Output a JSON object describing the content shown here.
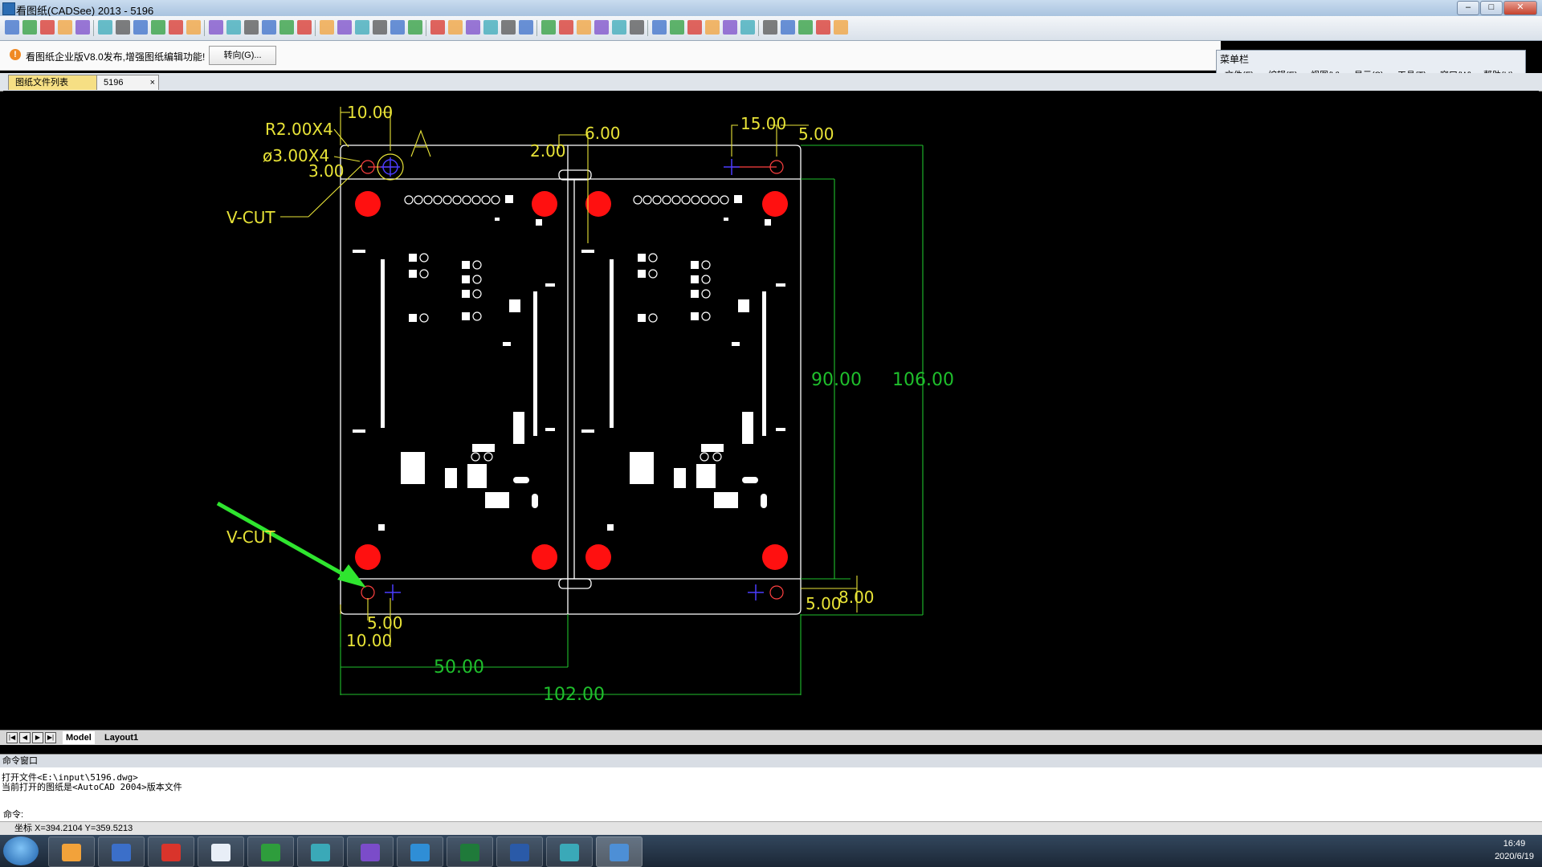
{
  "window": {
    "title": "看图纸(CADSee) 2013 - 5196",
    "controls": {
      "minimize": "–",
      "maximize": "□",
      "close": "✕"
    }
  },
  "notice": {
    "message": "看图纸企业版V8.0发布,增强图纸编辑功能!",
    "goto_label": "转向(G)..."
  },
  "menu_panel": {
    "caption": "菜单栏",
    "close": "×",
    "items": [
      "文件(F)",
      "编辑(E)",
      "视图(V)",
      "显示(S)",
      "工具(T)",
      "窗口(W)",
      "帮助(H)"
    ]
  },
  "tabs": {
    "file_list": "图纸文件列表",
    "current": "5196",
    "close": "×"
  },
  "layout_tabs": [
    "Model",
    "Layout1"
  ],
  "drawing": {
    "labels": {
      "r2": "R2.00X4",
      "phi3": "ø3.00X4",
      "dim3": "3.00",
      "vcut_top": "V-CUT",
      "vcut_bottom": "V-CUT",
      "marker_a": "A",
      "d10_top": "10.00",
      "d2": "2.00",
      "d6": "6.00",
      "d15": "15.00",
      "d5_top": "5.00",
      "d90": "90.00",
      "d106": "106.00",
      "d5_bl": "5.00",
      "d10_bl": "10.00",
      "d50": "50.00",
      "d102": "102.00",
      "d5_br": "5.00",
      "d8": "8.00"
    }
  },
  "command_window": {
    "caption": "命令窗口",
    "lines": [
      "打开文件<E:\\input\\5196.dwg>",
      "当前打开的图纸是<AutoCAD 2004>版本文件"
    ],
    "prompt": "命令:"
  },
  "status": {
    "coords": "坐标 X=394.2104 Y=359.5213"
  },
  "taskbar": {
    "clock_time": "16:49",
    "clock_date": "2020/6/19"
  },
  "colors": {
    "canvas": "#000000",
    "dimension_yellow": "#e8e337",
    "dimension_green": "#1fbf2c",
    "pad_red": "#ff1010",
    "arrow_green": "#2fe52f"
  }
}
